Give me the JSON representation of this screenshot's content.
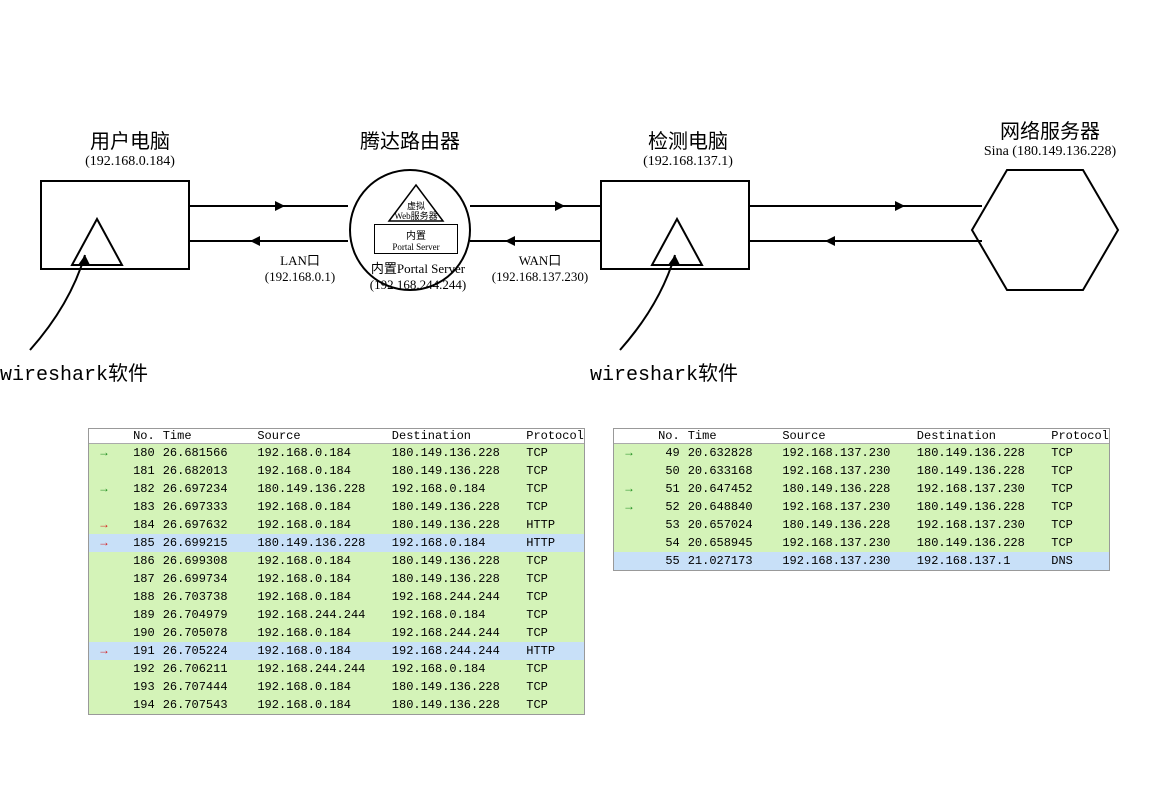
{
  "nodes": {
    "user_pc": {
      "title": "用户电脑",
      "ip": "(192.168.0.184)"
    },
    "router": {
      "title": "腾达路由器"
    },
    "detect_pc": {
      "title": "检测电脑",
      "ip": "(192.168.137.1)"
    },
    "web_server": {
      "title": "网络服务器",
      "sub": "Sina (180.149.136.228)"
    }
  },
  "router_inner": {
    "top": "虚拟",
    "top2": "Web服务器",
    "bot": "内置",
    "bot2": "Portal Server"
  },
  "labels": {
    "lan": "LAN口",
    "lan_ip": "(192.168.0.1)",
    "portal": "内置Portal Server",
    "portal_ip": "(192.168.244.244)",
    "wan": "WAN口",
    "wan_ip": "(192.168.137.230)",
    "wireshark": "wireshark软件"
  },
  "headers": [
    "No.",
    "Time",
    "Source",
    "Destination",
    "Protocol"
  ],
  "table_left": [
    {
      "arrow": "green",
      "no": "180",
      "time": "26.681566",
      "src": "192.168.0.184",
      "dst": "180.149.136.228",
      "proto": "TCP",
      "cls": "green"
    },
    {
      "arrow": "",
      "no": "181",
      "time": "26.682013",
      "src": "192.168.0.184",
      "dst": "180.149.136.228",
      "proto": "TCP",
      "cls": "green"
    },
    {
      "arrow": "green",
      "no": "182",
      "time": "26.697234",
      "src": "180.149.136.228",
      "dst": "192.168.0.184",
      "proto": "TCP",
      "cls": "green"
    },
    {
      "arrow": "",
      "no": "183",
      "time": "26.697333",
      "src": "192.168.0.184",
      "dst": "180.149.136.228",
      "proto": "TCP",
      "cls": "green"
    },
    {
      "arrow": "red",
      "no": "184",
      "time": "26.697632",
      "src": "192.168.0.184",
      "dst": "180.149.136.228",
      "proto": "HTTP",
      "cls": "green"
    },
    {
      "arrow": "red",
      "no": "185",
      "time": "26.699215",
      "src": "180.149.136.228",
      "dst": "192.168.0.184",
      "proto": "HTTP",
      "cls": "blue"
    },
    {
      "arrow": "",
      "no": "186",
      "time": "26.699308",
      "src": "192.168.0.184",
      "dst": "180.149.136.228",
      "proto": "TCP",
      "cls": "green"
    },
    {
      "arrow": "",
      "no": "187",
      "time": "26.699734",
      "src": "192.168.0.184",
      "dst": "180.149.136.228",
      "proto": "TCP",
      "cls": "green"
    },
    {
      "arrow": "",
      "no": "188",
      "time": "26.703738",
      "src": "192.168.0.184",
      "dst": "192.168.244.244",
      "proto": "TCP",
      "cls": "green"
    },
    {
      "arrow": "",
      "no": "189",
      "time": "26.704979",
      "src": "192.168.244.244",
      "dst": "192.168.0.184",
      "proto": "TCP",
      "cls": "green"
    },
    {
      "arrow": "",
      "no": "190",
      "time": "26.705078",
      "src": "192.168.0.184",
      "dst": "192.168.244.244",
      "proto": "TCP",
      "cls": "green"
    },
    {
      "arrow": "red",
      "no": "191",
      "time": "26.705224",
      "src": "192.168.0.184",
      "dst": "192.168.244.244",
      "proto": "HTTP",
      "cls": "blue"
    },
    {
      "arrow": "",
      "no": "192",
      "time": "26.706211",
      "src": "192.168.244.244",
      "dst": "192.168.0.184",
      "proto": "TCP",
      "cls": "green"
    },
    {
      "arrow": "",
      "no": "193",
      "time": "26.707444",
      "src": "192.168.0.184",
      "dst": "180.149.136.228",
      "proto": "TCP",
      "cls": "green"
    },
    {
      "arrow": "",
      "no": "194",
      "time": "26.707543",
      "src": "192.168.0.184",
      "dst": "180.149.136.228",
      "proto": "TCP",
      "cls": "green"
    }
  ],
  "table_right": [
    {
      "arrow": "green",
      "no": "49",
      "time": "20.632828",
      "src": "192.168.137.230",
      "dst": "180.149.136.228",
      "proto": "TCP",
      "cls": "green"
    },
    {
      "arrow": "",
      "no": "50",
      "time": "20.633168",
      "src": "192.168.137.230",
      "dst": "180.149.136.228",
      "proto": "TCP",
      "cls": "green"
    },
    {
      "arrow": "green",
      "no": "51",
      "time": "20.647452",
      "src": "180.149.136.228",
      "dst": "192.168.137.230",
      "proto": "TCP",
      "cls": "green"
    },
    {
      "arrow": "green",
      "no": "52",
      "time": "20.648840",
      "src": "192.168.137.230",
      "dst": "180.149.136.228",
      "proto": "TCP",
      "cls": "green"
    },
    {
      "arrow": "",
      "no": "53",
      "time": "20.657024",
      "src": "180.149.136.228",
      "dst": "192.168.137.230",
      "proto": "TCP",
      "cls": "green"
    },
    {
      "arrow": "",
      "no": "54",
      "time": "20.658945",
      "src": "192.168.137.230",
      "dst": "180.149.136.228",
      "proto": "TCP",
      "cls": "green"
    },
    {
      "arrow": "",
      "no": "55",
      "time": "21.027173",
      "src": "192.168.137.230",
      "dst": "192.168.137.1",
      "proto": "DNS",
      "cls": "blue"
    }
  ]
}
